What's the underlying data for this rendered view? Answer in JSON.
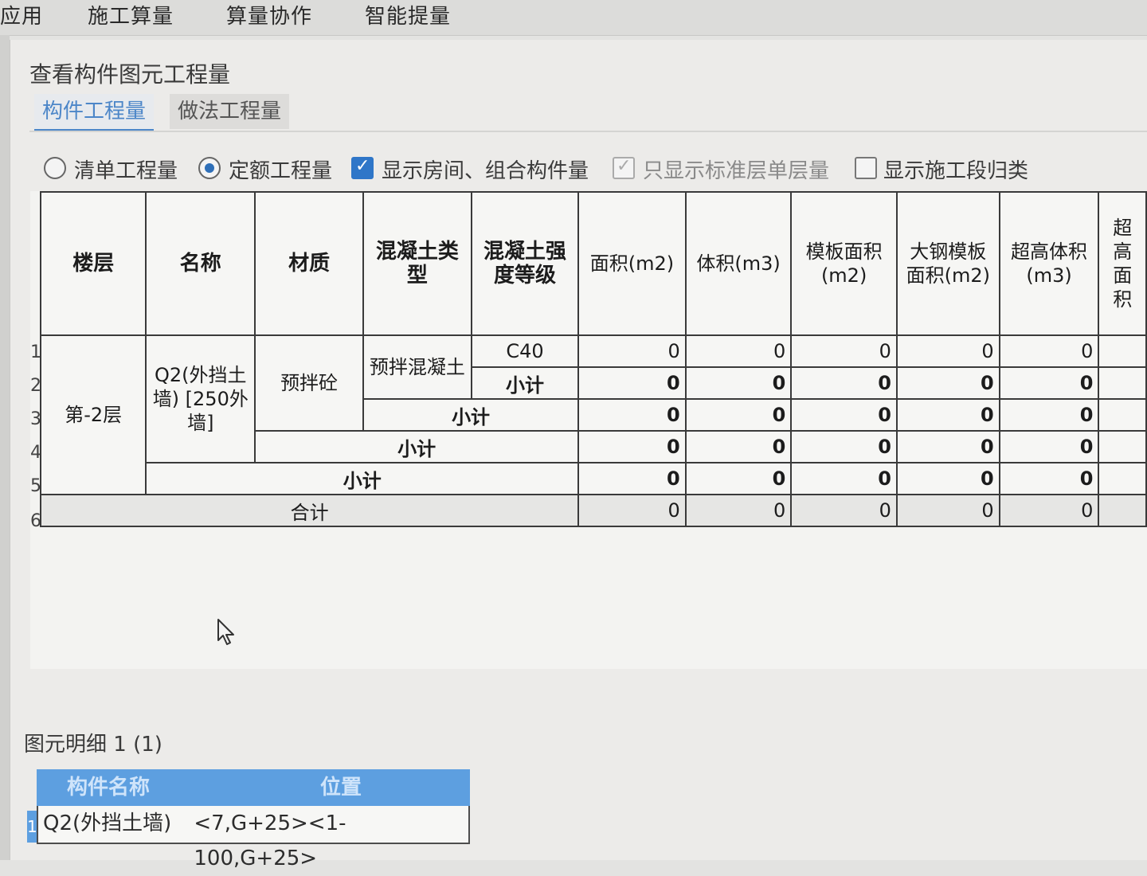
{
  "menubar": {
    "items": [
      "应用",
      "施工算量",
      "算量协作",
      "智能提量"
    ]
  },
  "dialog": {
    "title": "查看构件图元工程量",
    "tabs": [
      "构件工程量",
      "做法工程量"
    ],
    "options": {
      "radio_list": "清单工程量",
      "radio_quota": "定额工程量",
      "chk_show_rooms": "显示房间、组合构件量",
      "chk_std_floor": "只显示标准层单层量",
      "chk_construction_stage": "显示施工段归类"
    }
  },
  "grid": {
    "headers": {
      "floor": "楼层",
      "name": "名称",
      "material": "材质",
      "concrete_type": "混凝土类型",
      "concrete_grade": "混凝土强度等级",
      "area": "面积(m2)",
      "volume": "体积(m3)",
      "formwork_area": "模板面积(m2)",
      "steel_formwork_area": "大钢模板面积(m2)",
      "overheight_volume": "超高体积(m3)",
      "overheight_area": "超高面积"
    },
    "row_numbers": [
      "1",
      "2",
      "3",
      "4",
      "5",
      "6"
    ],
    "floor_value": "第-2层",
    "name_value": "Q2(外挡土墙) [250外墙]",
    "material_value": "预拌砼",
    "concrete_type_value": "预拌混凝土",
    "grade_value": "C40",
    "subtotal": "小计",
    "total": "合计",
    "values": {
      "r1": [
        "0",
        "0",
        "0",
        "0",
        "0"
      ],
      "r2": [
        "0",
        "0",
        "0",
        "0",
        "0"
      ],
      "r3": [
        "0",
        "0",
        "0",
        "0",
        "0"
      ],
      "r4": [
        "0",
        "0",
        "0",
        "0",
        "0"
      ],
      "r5": [
        "0",
        "0",
        "0",
        "0",
        "0"
      ],
      "r6": [
        "0",
        "0",
        "0",
        "0",
        "0"
      ]
    }
  },
  "detail": {
    "label": "图元明细  1 (1)",
    "columns": [
      "构件名称",
      "位置"
    ],
    "row_index": "1",
    "row": {
      "name": "Q2(外挡土墙)",
      "position": "<7,G+25><1-100,G+25>"
    }
  }
}
